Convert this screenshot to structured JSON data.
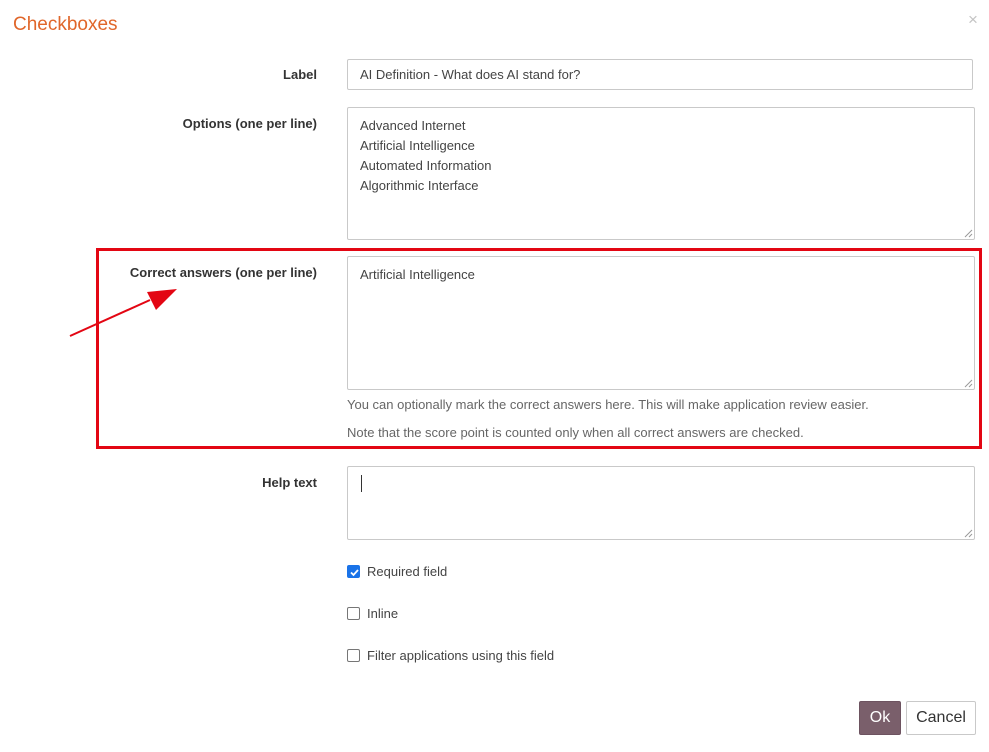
{
  "dialog": {
    "title": "Checkboxes",
    "close_glyph": "×"
  },
  "fields": {
    "label": {
      "label": "Label",
      "value": "AI Definition - What does AI stand for?"
    },
    "options": {
      "label": "Options (one per line)",
      "lines": [
        "Advanced Internet",
        "Artificial Intelligence",
        "Automated Information",
        "Algorithmic Interface"
      ]
    },
    "correct_answers": {
      "label": "Correct answers (one per line)",
      "lines": [
        "Artificial Intelligence"
      ],
      "hint1": "You can optionally mark the correct answers here. This will make application review easier.",
      "hint2": "Note that the score point is counted only when all correct answers are checked."
    },
    "help_text": {
      "label": "Help text",
      "value": ""
    }
  },
  "checkboxes": [
    {
      "label": "Required field",
      "checked": true
    },
    {
      "label": "Inline",
      "checked": false
    },
    {
      "label": "Filter applications using this field",
      "checked": false
    }
  ],
  "buttons": {
    "ok": "Ok",
    "cancel": "Cancel"
  },
  "colors": {
    "title": "#e0662a",
    "highlight": "#e30613",
    "ok_button": "#7a5f6b",
    "checkbox_checked": "#1a73e8"
  }
}
